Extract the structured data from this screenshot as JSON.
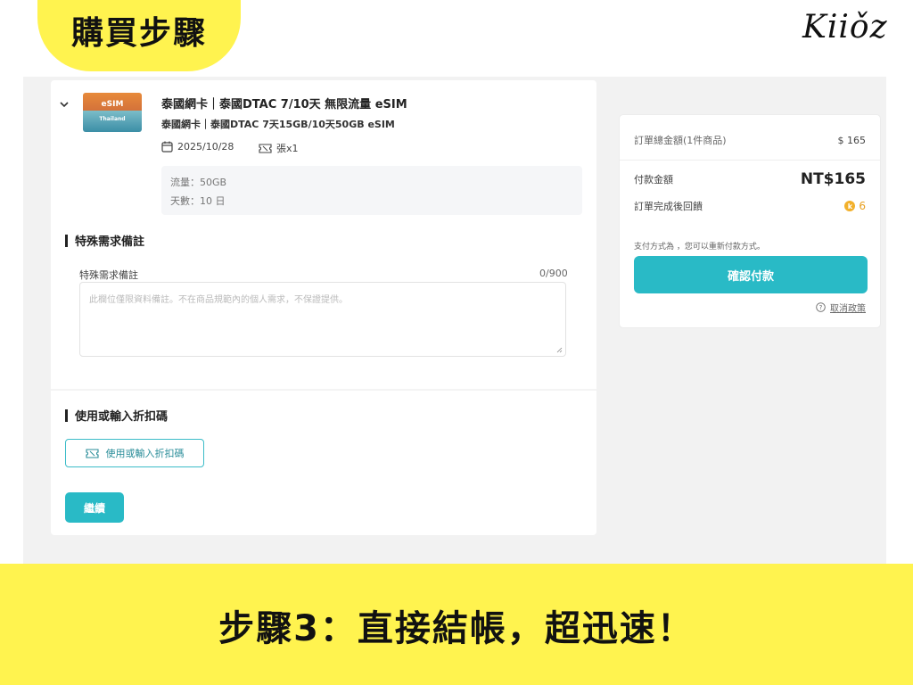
{
  "banner": {
    "title": "購買步驟",
    "logo": "Kiiǒz",
    "caption": "步驟3：直接結帳，超迅速！"
  },
  "product": {
    "thumbnail_text": "eSIM",
    "thumbnail_sub": "Thailand",
    "title": "泰國網卡｜泰國DTAC 7/10天 無限流量 eSIM",
    "subtitle": "泰國網卡｜泰國DTAC 7天15GB/10天50GB eSIM",
    "date": "2025/10/28",
    "quantity": "張x1",
    "specs": [
      "流量：50GB",
      "天數：10 日"
    ]
  },
  "special_request": {
    "section_title": "特殊需求備註",
    "field_label": "特殊需求備註",
    "counter": "0/900",
    "placeholder": "此欄位僅限資料備註。不在商品規範內的個人需求，不保證提供。"
  },
  "coupon": {
    "section_title": "使用或輸入折扣碼",
    "button_label": "使用或輸入折扣碼"
  },
  "continue_label": "繼續",
  "summary": {
    "total_label": "訂單總金額(1件商品)",
    "total_value": "$ 165",
    "pay_label": "付款金額",
    "pay_value": "NT$165",
    "reward_label": "訂單完成後回饋",
    "reward_value": "6",
    "payment_note": "支付方式為 ，您可以重新付款方式。",
    "confirm_label": "確認付款",
    "policy_label": "取消政策"
  },
  "colors": {
    "accent": "#29bac6",
    "banner": "#fff34f",
    "coin": "#f2b02b"
  }
}
